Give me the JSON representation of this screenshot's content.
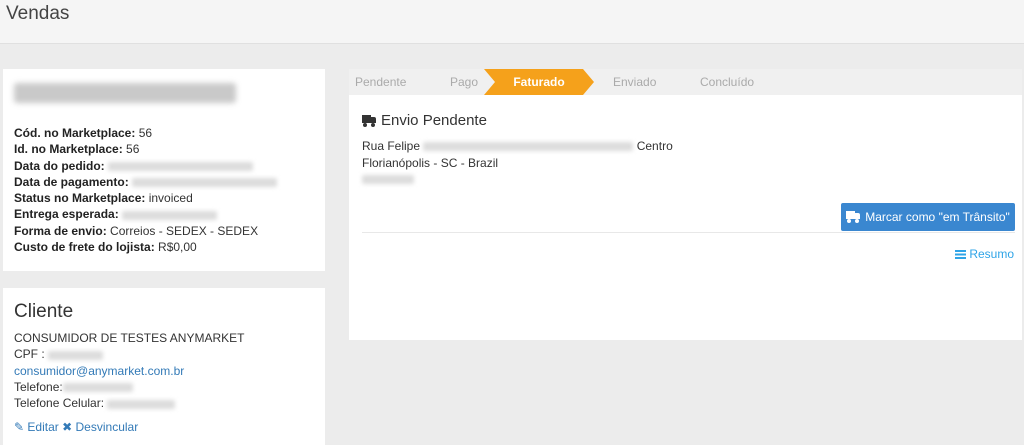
{
  "page": {
    "title": "Vendas"
  },
  "order": {
    "fields": [
      {
        "label": "Cód. no Marketplace",
        "value": "56"
      },
      {
        "label": "Id. no Marketplace",
        "value": "56"
      },
      {
        "label": "Data do pedido",
        "value": ""
      },
      {
        "label": "Data de pagamento",
        "value": ""
      },
      {
        "label": "Status no Marketplace",
        "value": "invoiced"
      },
      {
        "label": "Entrega esperada",
        "value": ""
      },
      {
        "label": "Forma de envio",
        "value": "Correios - SEDEX - SEDEX"
      },
      {
        "label": "Custo de frete do lojista",
        "value": "R$0,00"
      }
    ]
  },
  "client": {
    "title": "Cliente",
    "name": "CONSUMIDOR DE TESTES ANYMARKET",
    "cpf_label": "CPF :",
    "email": "consumidor@anymarket.com.br",
    "phone_label": "Telefone:",
    "mobile_label": "Telefone Celular:",
    "edit_label": "Editar",
    "unlink_label": "Desvincular"
  },
  "steps": [
    "Pendente",
    "Pago",
    "Faturado",
    "Enviado",
    "Concluído"
  ],
  "active_step": "Faturado",
  "shipping": {
    "title": "Envio Pendente",
    "street_prefix": "Rua Felipe",
    "district": "Centro",
    "city_line": "Florianópolis - SC - Brazil",
    "transit_button": "Marcar como \"em Trânsito\"",
    "summary_link": "Resumo"
  },
  "colors": {
    "accent": "#f5a11b",
    "primary_button": "#3a87d0",
    "link": "#337ab7",
    "info_link": "#2fa4e7"
  },
  "icons": [
    "truck-icon",
    "pencil-icon",
    "close-icon",
    "list-icon"
  ]
}
